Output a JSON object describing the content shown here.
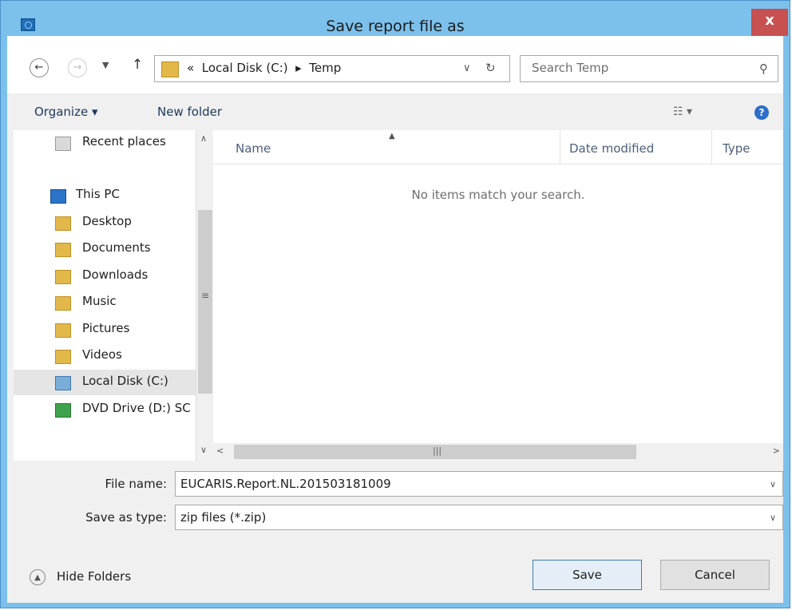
{
  "window": {
    "title": "Save report file as",
    "close_label": "x"
  },
  "address": {
    "chevron": "«",
    "path": [
      "Local Disk (C:)",
      "Temp"
    ],
    "separator": "▸",
    "search_placeholder": "Search Temp"
  },
  "toolbar": {
    "organize_label": "Organize ▾",
    "new_folder_label": "New folder"
  },
  "nav_pane": {
    "items": [
      {
        "label": "Recent places",
        "icon": "recent-places-icon",
        "selected": false
      },
      {
        "label": "This PC",
        "icon": "computer-icon",
        "selected": false
      },
      {
        "label": "Desktop",
        "icon": "desktop-folder-icon",
        "selected": false
      },
      {
        "label": "Documents",
        "icon": "documents-folder-icon",
        "selected": false
      },
      {
        "label": "Downloads",
        "icon": "downloads-folder-icon",
        "selected": false
      },
      {
        "label": "Music",
        "icon": "music-folder-icon",
        "selected": false
      },
      {
        "label": "Pictures",
        "icon": "pictures-folder-icon",
        "selected": false
      },
      {
        "label": "Videos",
        "icon": "videos-folder-icon",
        "selected": false
      },
      {
        "label": "Local Disk (C:)",
        "icon": "drive-icon",
        "selected": true
      },
      {
        "label": "DVD Drive (D:) SC",
        "icon": "dvd-drive-icon",
        "selected": false
      }
    ]
  },
  "file_list": {
    "columns": [
      "Name",
      "Date modified",
      "Type"
    ],
    "empty_message": "No items match your search."
  },
  "form": {
    "file_name_label": "File name:",
    "file_name_value": "EUCARIS.Report.NL.201503181009",
    "save_type_label": "Save as type:",
    "save_type_value": "zip files (*.zip)"
  },
  "footer": {
    "hide_folders_label": "Hide Folders",
    "save_label": "Save",
    "cancel_label": "Cancel"
  },
  "colors": {
    "titlebar": "#7cc1ec",
    "close_button": "#c75050",
    "selection": "#e5e5e5",
    "primary_button_border": "#3c7fb1"
  }
}
